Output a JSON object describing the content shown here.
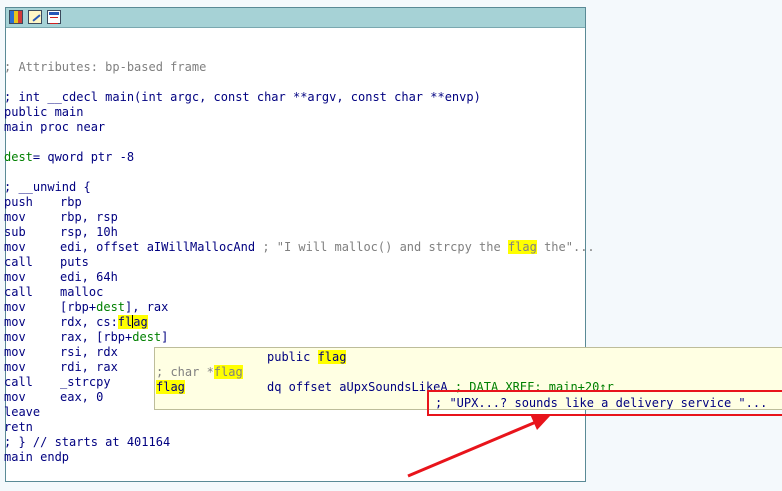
{
  "colors": {
    "panel_border": "#5a8a96",
    "titlebar": "#a6d2d6",
    "instruction": "#000080",
    "comment": "#808080",
    "variable": "#008000",
    "highlight": "#ffff00",
    "tooltip_bg": "#ffffe3",
    "annotation_red": "#e8141b"
  },
  "toolbar": {
    "icons": [
      "graph-view-icon",
      "edit-icon",
      "structures-icon"
    ]
  },
  "code": {
    "attributes_comment": "; Attributes: bp-based frame",
    "signature": "; int __cdecl main(int argc, const char **argv, const char **envp)",
    "public_main": "public main",
    "proc_decl": "main proc near",
    "dest_name": "dest",
    "dest_def": "= qword ptr -8",
    "unwind": "; __unwind {",
    "instructions": [
      {
        "mnemonic": "push",
        "operands": "rbp"
      },
      {
        "mnemonic": "mov",
        "operands": "rbp, rsp"
      },
      {
        "mnemonic": "sub",
        "operands": "rsp, 10h"
      },
      {
        "mnemonic": "mov",
        "operands": "edi, offset aIWillMallocAnd",
        "comment_prefix": "; \"I will malloc() and strcpy the ",
        "comment_hl": "flag",
        "comment_suffix": " the\"..."
      },
      {
        "mnemonic": "call",
        "operands": "puts"
      },
      {
        "mnemonic": "mov",
        "operands": "edi, 64h"
      },
      {
        "mnemonic": "call",
        "operands": "malloc"
      },
      {
        "mnemonic": "mov",
        "operands_prefix": "[rbp+",
        "operands_var": "dest",
        "operands_suffix": "], rax"
      },
      {
        "mnemonic": "mov",
        "operands_prefix": "rdx, cs:",
        "operands_hl_a": "fl",
        "operands_hl_b": "ag"
      },
      {
        "mnemonic": "mov",
        "operands_prefix": "rax, [rbp+",
        "operands_var": "dest",
        "operands_suffix": "]"
      },
      {
        "mnemonic": "mov",
        "operands": "rsi, rdx"
      },
      {
        "mnemonic": "mov",
        "operands": "rdi, rax"
      },
      {
        "mnemonic": "call",
        "operands": "_strcpy"
      },
      {
        "mnemonic": "mov",
        "operands": "eax, 0"
      },
      {
        "mnemonic": "leave",
        "operands": ""
      },
      {
        "mnemonic": "retn",
        "operands": ""
      }
    ],
    "end_comment": "; } // starts at 401164",
    "endp": "main endp"
  },
  "tooltip": {
    "public_kw": "public ",
    "public_name": "flag",
    "type_comment_prefix": "; char *",
    "type_comment_name": "flag",
    "def_name": "flag",
    "def_body": "dq offset aUpxSoundsLikeA",
    "xref": " ; DATA XREF: main+20↑r",
    "string_comment": "; \"UPX...? sounds like a delivery service \"..."
  }
}
